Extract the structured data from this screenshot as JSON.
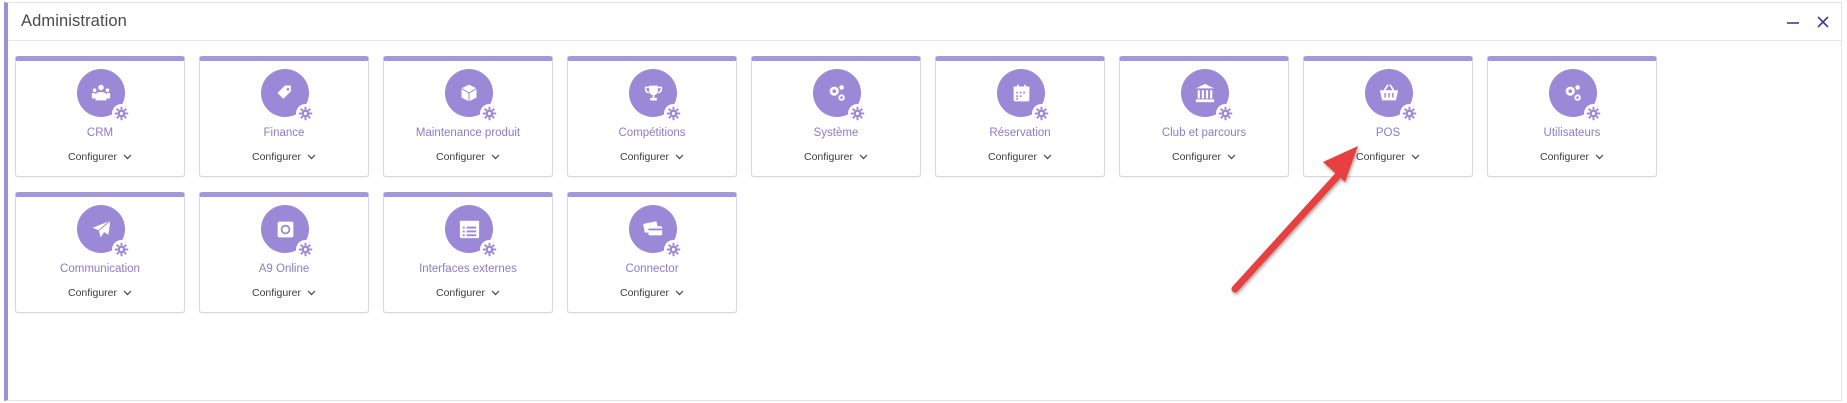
{
  "window": {
    "title": "Administration",
    "minimize_icon": "minimize-icon",
    "close_icon": "close-icon"
  },
  "tiles": [
    {
      "label": "CRM",
      "icon": "crm-icon",
      "action": "Configurer"
    },
    {
      "label": "Finance",
      "icon": "tag-icon",
      "action": "Configurer"
    },
    {
      "label": "Maintenance produit",
      "icon": "package-icon",
      "action": "Configurer"
    },
    {
      "label": "Compétitions",
      "icon": "trophy-icon",
      "action": "Configurer"
    },
    {
      "label": "Système",
      "icon": "gears-icon",
      "action": "Configurer"
    },
    {
      "label": "Réservation",
      "icon": "calendar-icon",
      "action": "Configurer"
    },
    {
      "label": "Club et parcours",
      "icon": "bank-icon",
      "action": "Configurer"
    },
    {
      "label": "POS",
      "icon": "basket-icon",
      "action": "Configurer"
    },
    {
      "label": "Utilisateurs",
      "icon": "user-gear-icon",
      "action": "Configurer"
    },
    {
      "label": "Communication",
      "icon": "paper-plane-icon",
      "action": "Configurer"
    },
    {
      "label": "A9 Online",
      "icon": "online-icon",
      "action": "Configurer"
    },
    {
      "label": "Interfaces externes",
      "icon": "window-list-icon",
      "action": "Configurer"
    },
    {
      "label": "Connector",
      "icon": "cards-icon",
      "action": "Configurer"
    }
  ],
  "colors": {
    "accent": "#9b88d6",
    "tile_top_border": "#a698d8",
    "label": "#8b7cc9",
    "annotation_arrow": "#e8403f"
  },
  "annotation": {
    "type": "arrow",
    "target": "POS"
  }
}
